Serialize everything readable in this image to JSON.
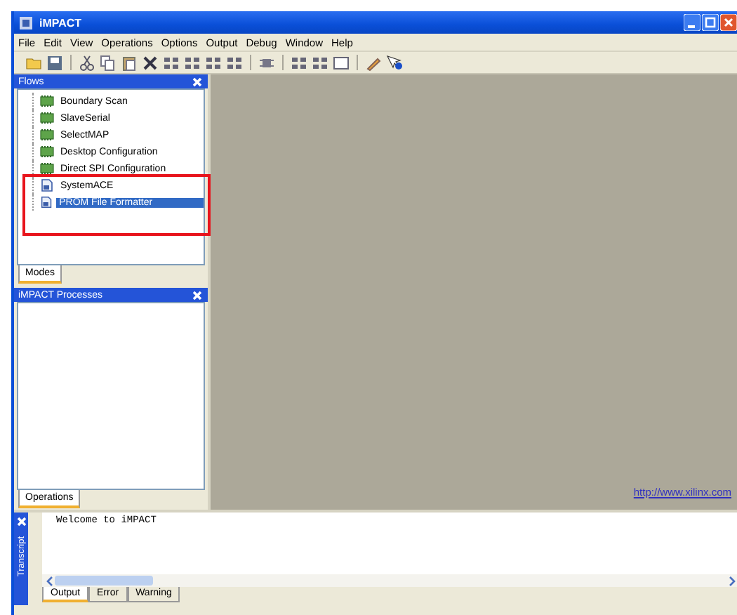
{
  "window": {
    "title": "iMPACT"
  },
  "menu": [
    "File",
    "Edit",
    "View",
    "Operations",
    "Options",
    "Output",
    "Debug",
    "Window",
    "Help"
  ],
  "flows_panel": {
    "title": "Flows",
    "items": [
      {
        "label": "Boundary Scan",
        "kind": "chip",
        "selected": false
      },
      {
        "label": "SlaveSerial",
        "kind": "chip",
        "selected": false
      },
      {
        "label": "SelectMAP",
        "kind": "chip",
        "selected": false
      },
      {
        "label": "Desktop Configuration",
        "kind": "chip",
        "selected": false
      },
      {
        "label": "Direct SPI Configuration",
        "kind": "chip",
        "selected": false
      },
      {
        "label": "SystemACE",
        "kind": "doc",
        "selected": false
      },
      {
        "label": "PROM File Formatter",
        "kind": "doc",
        "selected": true
      }
    ],
    "tabs": [
      {
        "label": "Modes",
        "selected": true
      }
    ]
  },
  "processes_panel": {
    "title": "iMPACT Processes",
    "tabs": [
      {
        "label": "Operations",
        "selected": true
      }
    ]
  },
  "link": "http://www.xilinx.com",
  "transcript": {
    "title": "Transcript",
    "lines": [
      "Welcome to iMPACT"
    ],
    "tabs": [
      {
        "label": "Output",
        "selected": true
      },
      {
        "label": "Error",
        "selected": false
      },
      {
        "label": "Warning",
        "selected": false
      }
    ]
  }
}
